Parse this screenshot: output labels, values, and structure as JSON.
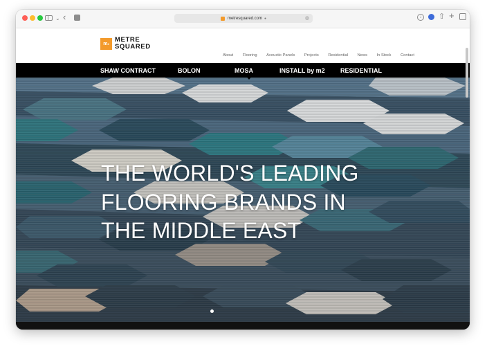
{
  "browser": {
    "url": "metresquared.com"
  },
  "logo": {
    "mark": "m",
    "mark_sup": "2",
    "line1": "METRE",
    "line2": "SQUARED"
  },
  "nav": {
    "items": [
      "About",
      "Flooring",
      "Acoustic Panels",
      "Projects",
      "Residential",
      "News",
      "In Stock",
      "Contact"
    ]
  },
  "brands": {
    "items": [
      "SHAW CONTRACT",
      "BOLON",
      "MOSA",
      "INSTALL by m2",
      "RESIDENTIAL"
    ]
  },
  "hero": {
    "line1": "THE WORLD'S LEADING",
    "line2": "FLOORING BRANDS IN",
    "line3": "THE MIDDLE EAST"
  },
  "colors": {
    "brand_orange": "#f39a2b",
    "brand_bar": "#000000"
  }
}
